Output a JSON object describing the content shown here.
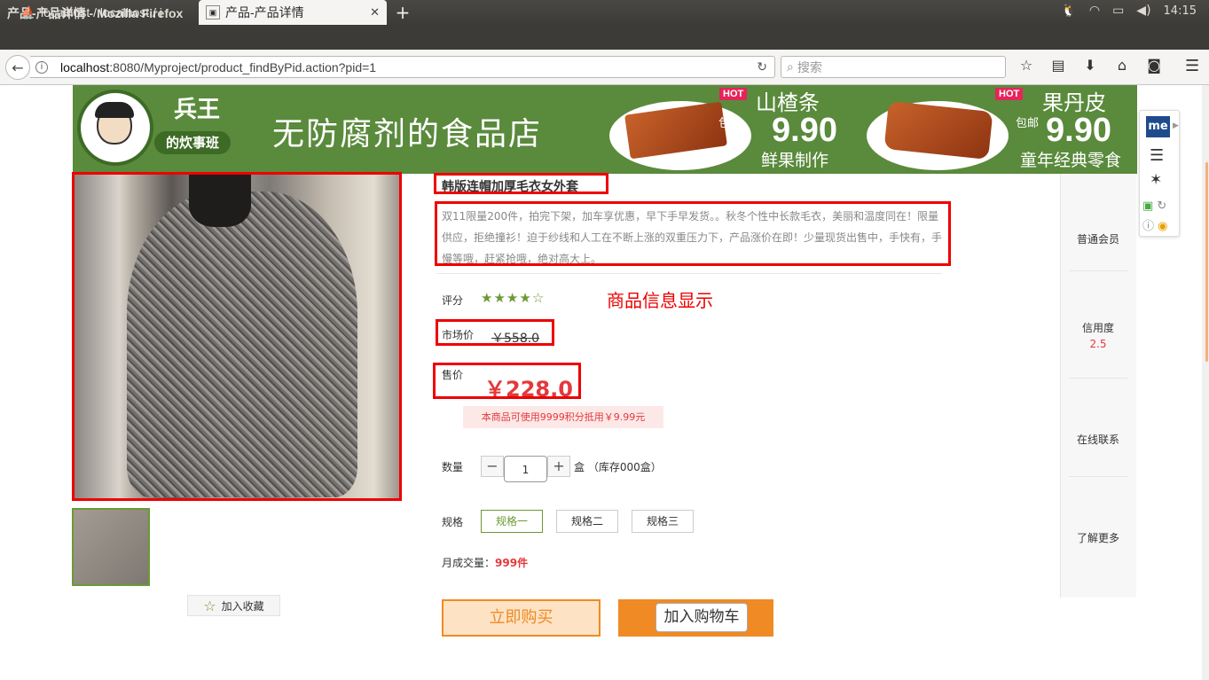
{
  "window": {
    "title": "产品-产品详情 - Mozilla Firefox"
  },
  "tray": {
    "time": "14:15"
  },
  "tabs": [
    {
      "label": "localhost / localhost / i",
      "active": false
    },
    {
      "label": "产品-产品详情",
      "active": true
    }
  ],
  "navbar": {
    "url_host": "localhost",
    "url_rest": ":8080/Myproject/product_findByPid.action?pid=1",
    "search_placeholder": "搜索"
  },
  "banner": {
    "logo_text": "兵王",
    "logo_badge": "的炊事班",
    "shop_name": "无防腐剂的食品店",
    "promos": [
      {
        "badge": "HOT",
        "title": "山楂条",
        "free_ship": "包邮",
        "price": "9.90",
        "subtitle": "鲜果制作"
      },
      {
        "badge": "HOT",
        "title": "果丹皮",
        "free_ship": "包邮",
        "price": "9.90",
        "subtitle": "童年经典零食"
      }
    ]
  },
  "product": {
    "title": "韩版连帽加厚毛衣女外套",
    "description": "双11限量200件，拍完下架，加车享优惠，早下手早发货。。秋冬个性中长款毛衣，美丽和温度同在！限量供应，拒绝撞衫！迫于纱线和人工在不断上涨的双重压力下，产品涨价在即！少量现货出售中，手快有，手慢等哦，赶紧抢哦，绝对高大上。",
    "rating_label": "评分",
    "rating": 4,
    "rating_max": 5,
    "annotation": "商品信息显示",
    "market_price_label": "市场价",
    "market_price": "￥558.0",
    "sale_price_label": "售价",
    "sale_price": "￥228.0",
    "points_note": "本商品可使用9999积分抵用￥9.99元",
    "quantity_label": "数量",
    "quantity_minus": "−",
    "quantity": "1",
    "quantity_plus": "+",
    "quantity_unit": "盒 （库存000盒）",
    "spec_label": "规格",
    "specs": [
      "规格一",
      "规格二",
      "规格三"
    ],
    "selected_spec": "规格一",
    "monthly_sales_label": "月成交量：",
    "monthly_sales": "999件",
    "favorite_label": "加入收藏",
    "buy_now_label": "立即购买",
    "add_cart_label": "加入购物车"
  },
  "sidebar": {
    "member_level": "普通会员",
    "credit_label": "信用度",
    "credit_value": "2.5",
    "contact": "在线联系",
    "more": "了解更多"
  },
  "extension": {
    "badge": "me"
  },
  "colors": {
    "accent_green": "#6b9a33",
    "price_red": "#e4393c",
    "orange": "#f08a24",
    "annotation_red": "#e00000"
  }
}
